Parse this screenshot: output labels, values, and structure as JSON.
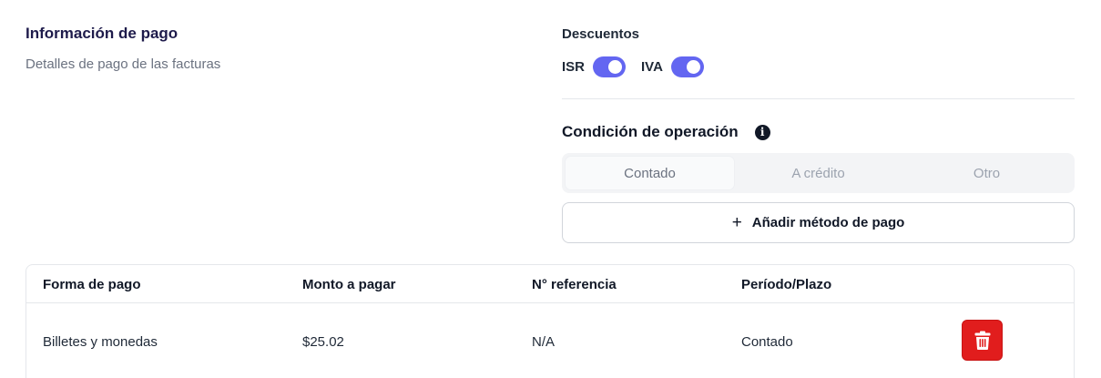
{
  "payment_info": {
    "title": "Información de pago",
    "description": "Detalles de pago de las facturas"
  },
  "discounts": {
    "label": "Descuentos",
    "toggles": [
      {
        "label": "ISR",
        "enabled": true
      },
      {
        "label": "IVA",
        "enabled": true
      }
    ],
    "toggle_color": "#6366f1"
  },
  "operation_condition": {
    "title": "Condición de operación",
    "info_icon": "info-icon",
    "options": [
      "Contado",
      "A crédito",
      "Otro"
    ],
    "selected": "Contado"
  },
  "add_method": {
    "icon": "plus-icon",
    "label": "Añadir método de pago"
  },
  "table": {
    "headers": [
      "Forma de pago",
      "Monto a pagar",
      "N° referencia",
      "Período/Plazo"
    ],
    "rows": [
      {
        "forma_de_pago": "Billetes y monedas",
        "monto": "$25.02",
        "referencia": "N/A",
        "periodo": "Contado",
        "action_icon": "trash-icon",
        "action_color": "#e11d1d"
      }
    ]
  }
}
